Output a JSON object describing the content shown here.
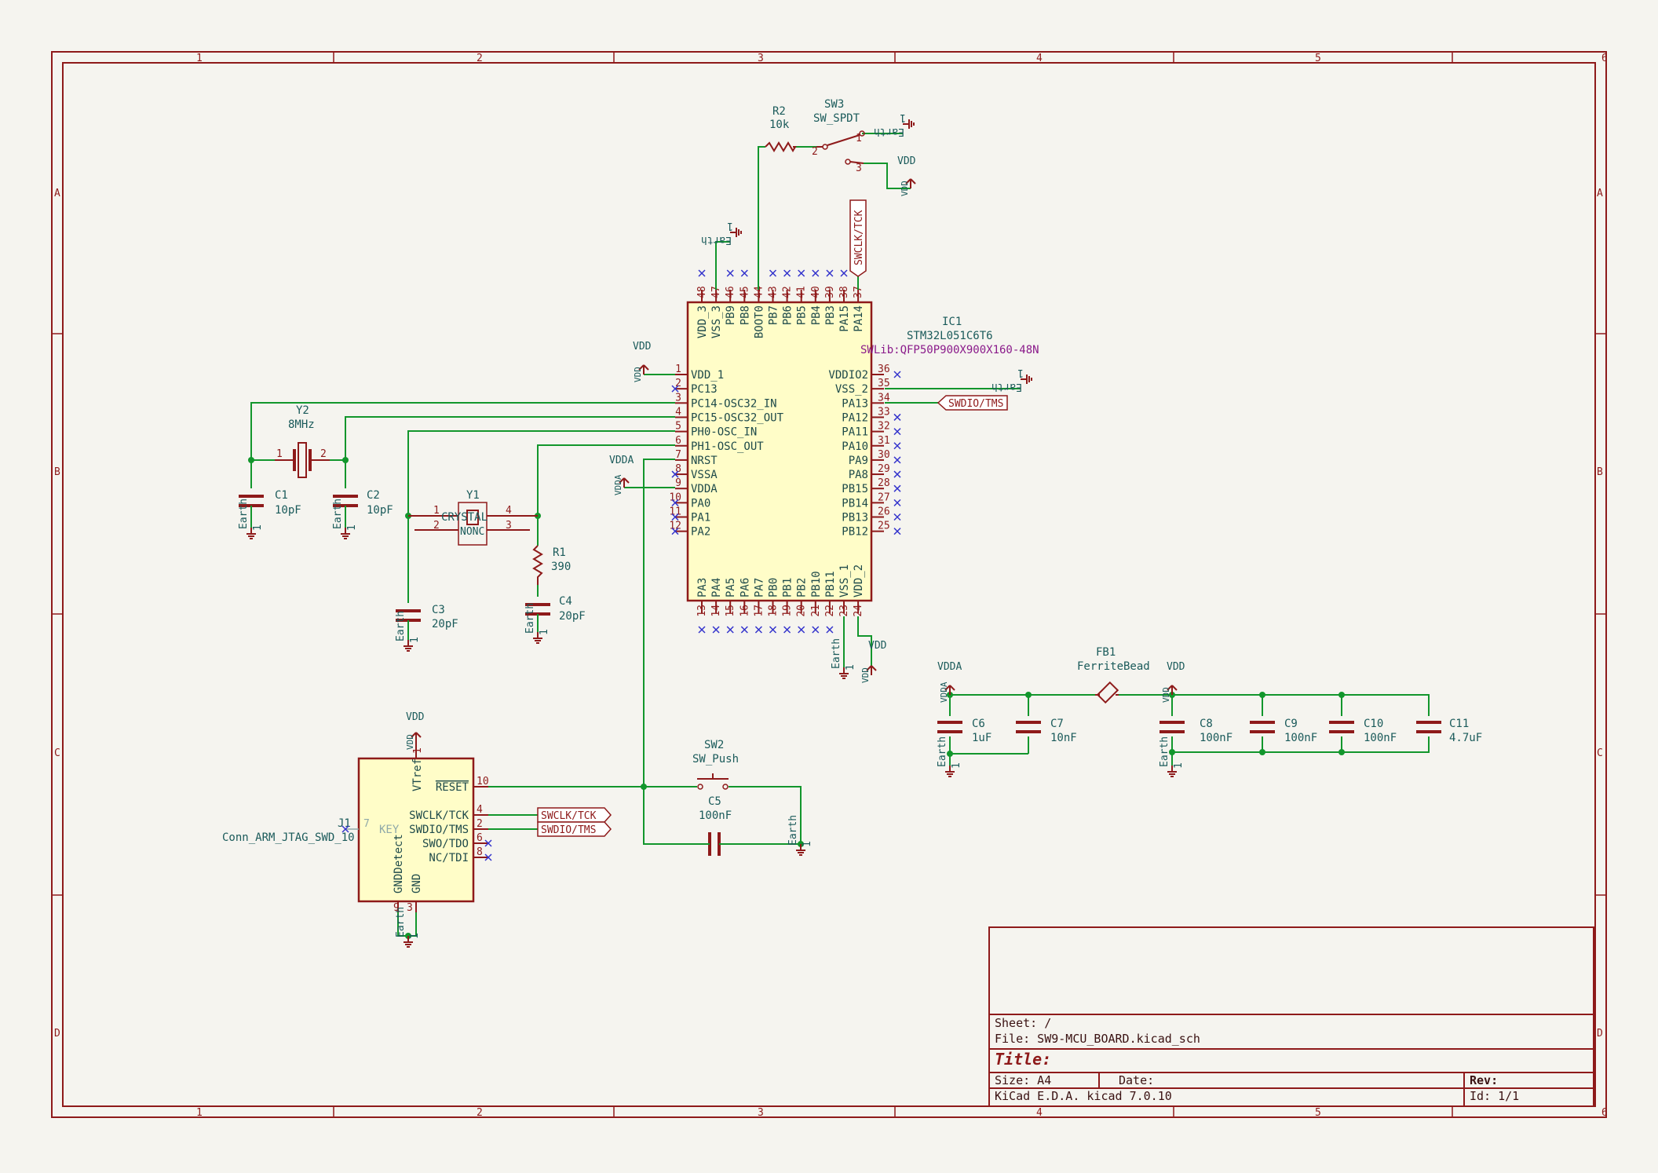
{
  "sheet": {
    "zones_top": [
      "1",
      "2",
      "3",
      "4",
      "5",
      "6"
    ],
    "zones_side": [
      "A",
      "B",
      "C",
      "D"
    ]
  },
  "title_block": {
    "sheet": "Sheet: /",
    "file": "File: SW9-MCU_BOARD.kicad_sch",
    "title": "Title:",
    "size": "Size: A4",
    "date": "Date:",
    "rev": "Rev:",
    "tool": "KiCad E.D.A.  kicad 7.0.10",
    "id": "Id: 1/1"
  },
  "ic1": {
    "ref": "IC1",
    "value": "STM32L051C6T6",
    "footprint": "SWLib:QFP50P900X900X160-48N",
    "left_pins": [
      {
        "num": "1",
        "name": "VDD_1"
      },
      {
        "num": "2",
        "name": "PC13"
      },
      {
        "num": "3",
        "name": "PC14-OSC32_IN"
      },
      {
        "num": "4",
        "name": "PC15-OSC32_OUT"
      },
      {
        "num": "5",
        "name": "PH0-OSC_IN"
      },
      {
        "num": "6",
        "name": "PH1-OSC_OUT"
      },
      {
        "num": "7",
        "name": "NRST"
      },
      {
        "num": "8",
        "name": "VSSA"
      },
      {
        "num": "9",
        "name": "VDDA"
      },
      {
        "num": "10",
        "name": "PA0"
      },
      {
        "num": "11",
        "name": "PA1"
      },
      {
        "num": "12",
        "name": "PA2"
      }
    ],
    "right_pins": [
      {
        "num": "36",
        "name": "VDDIO2"
      },
      {
        "num": "35",
        "name": "VSS_2"
      },
      {
        "num": "34",
        "name": "PA13"
      },
      {
        "num": "33",
        "name": "PA12"
      },
      {
        "num": "32",
        "name": "PA11"
      },
      {
        "num": "31",
        "name": "PA10"
      },
      {
        "num": "30",
        "name": "PA9"
      },
      {
        "num": "29",
        "name": "PA8"
      },
      {
        "num": "28",
        "name": "PB15"
      },
      {
        "num": "27",
        "name": "PB14"
      },
      {
        "num": "26",
        "name": "PB13"
      },
      {
        "num": "25",
        "name": "PB12"
      }
    ],
    "top_pins": [
      {
        "num": "48",
        "name": "VDD_3"
      },
      {
        "num": "47",
        "name": "VSS_3"
      },
      {
        "num": "46",
        "name": "PB9"
      },
      {
        "num": "45",
        "name": "PB8"
      },
      {
        "num": "44",
        "name": "BOOT0"
      },
      {
        "num": "43",
        "name": "PB7"
      },
      {
        "num": "42",
        "name": "PB6"
      },
      {
        "num": "41",
        "name": "PB5"
      },
      {
        "num": "40",
        "name": "PB4"
      },
      {
        "num": "39",
        "name": "PB3"
      },
      {
        "num": "38",
        "name": "PA15"
      },
      {
        "num": "37",
        "name": "PA14"
      }
    ],
    "bottom_pins": [
      {
        "num": "13",
        "name": "PA3"
      },
      {
        "num": "14",
        "name": "PA4"
      },
      {
        "num": "15",
        "name": "PA5"
      },
      {
        "num": "16",
        "name": "PA6"
      },
      {
        "num": "17",
        "name": "PA7"
      },
      {
        "num": "18",
        "name": "PB0"
      },
      {
        "num": "19",
        "name": "PB1"
      },
      {
        "num": "20",
        "name": "PB2"
      },
      {
        "num": "21",
        "name": "PB10"
      },
      {
        "num": "22",
        "name": "PB11"
      },
      {
        "num": "23",
        "name": "VSS_1"
      },
      {
        "num": "24",
        "name": "VDD_2"
      }
    ]
  },
  "components": {
    "y2": {
      "ref": "Y2",
      "value": "8MHz",
      "p1": "1",
      "p2": "2"
    },
    "y1": {
      "ref": "Y1",
      "value": "CRYSTAL",
      "inner": "NONC",
      "p1": "1",
      "p2": "2",
      "p3": "3",
      "p4": "4"
    },
    "c1": {
      "ref": "C1",
      "value": "10pF"
    },
    "c2": {
      "ref": "C2",
      "value": "10pF"
    },
    "c3": {
      "ref": "C3",
      "value": "20pF"
    },
    "c4": {
      "ref": "C4",
      "value": "20pF"
    },
    "r1": {
      "ref": "R1",
      "value": "390"
    },
    "r2": {
      "ref": "R2",
      "value": "10k"
    },
    "sw3": {
      "ref": "SW3",
      "value": "SW_SPDT",
      "p1": "1",
      "p2": "2",
      "p3": "3"
    },
    "sw2": {
      "ref": "SW2",
      "value": "SW_Push"
    },
    "c5": {
      "ref": "C5",
      "value": "100nF"
    },
    "fb1": {
      "ref": "FB1",
      "value": "FerriteBead"
    },
    "c6": {
      "ref": "C6",
      "value": "1uF"
    },
    "c7": {
      "ref": "C7",
      "value": "10nF"
    },
    "c8": {
      "ref": "C8",
      "value": "100nF"
    },
    "c9": {
      "ref": "C9",
      "value": "100nF"
    },
    "c10": {
      "ref": "C10",
      "value": "100nF"
    },
    "c11": {
      "ref": "C11",
      "value": "4.7uF"
    }
  },
  "j1": {
    "ref": "J1",
    "value": "Conn_ARM_JTAG_SWD_10",
    "pins_right": [
      {
        "num": "10",
        "name": "RESET"
      },
      {
        "num": "4",
        "name": "SWCLK/TCK"
      },
      {
        "num": "2",
        "name": "SWDIO/TMS"
      },
      {
        "num": "6",
        "name": "SWO/TDO"
      },
      {
        "num": "8",
        "name": "NC/TDI"
      }
    ],
    "vtref": "VTref",
    "vtref_num": "1",
    "key": "KEY",
    "key_num": "7",
    "gnddetect": "GNDDetect",
    "gnddetect_num": "9",
    "gnd": "GND",
    "gnd_num": "3"
  },
  "power": {
    "vdd": "VDD",
    "vdda": "VDDA",
    "earth": "Earth",
    "one": "1"
  },
  "labels": {
    "swclk": "SWCLK/TCK",
    "swdio": "SWDIO/TMS"
  },
  "colors": {
    "frame": "#8e1a1a",
    "wire": "#12962c",
    "body": "#fffdc8",
    "text": "#1a5a5a",
    "nc": "#3333cc",
    "background": "#f5f4ef"
  }
}
